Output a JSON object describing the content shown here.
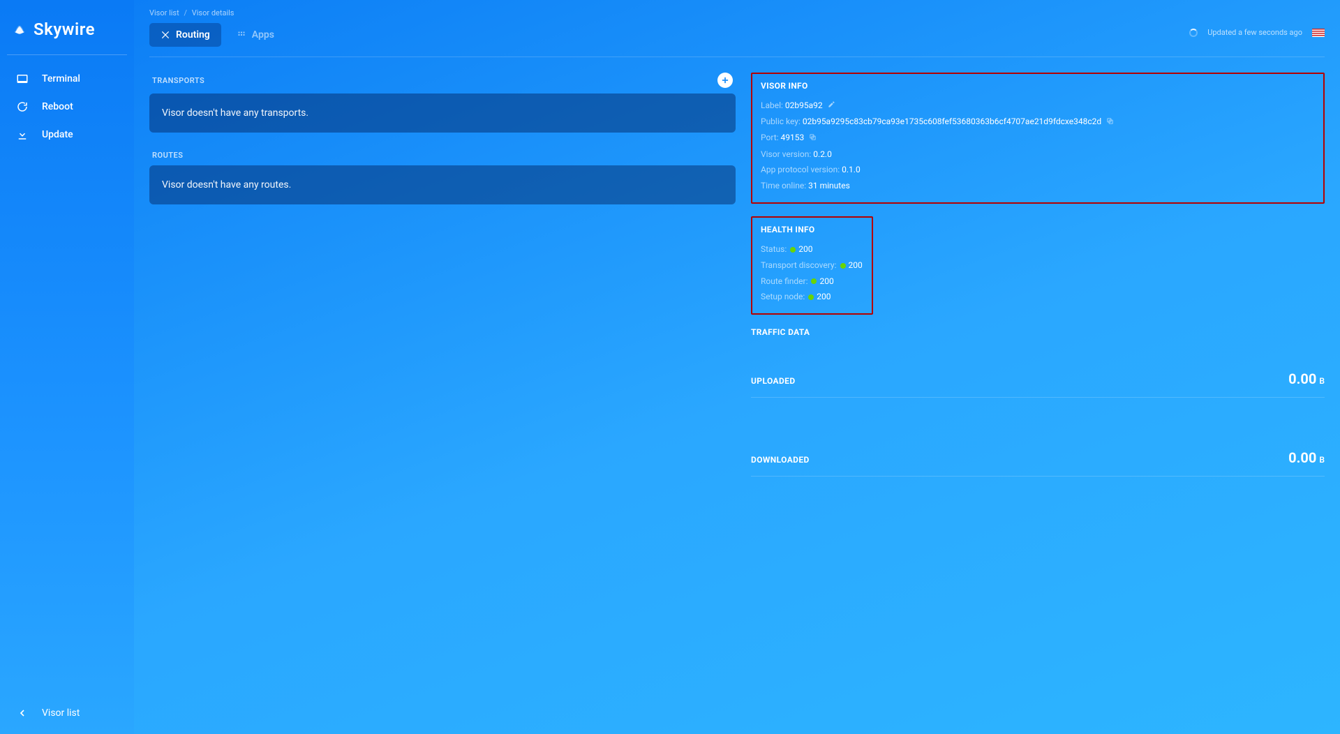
{
  "app": {
    "name": "Skywire"
  },
  "sidebar": {
    "items": [
      {
        "label": "Terminal",
        "name": "sidebar-item-terminal",
        "icon": "terminal-icon"
      },
      {
        "label": "Reboot",
        "name": "sidebar-item-reboot",
        "icon": "reboot-icon"
      },
      {
        "label": "Update",
        "name": "sidebar-item-update",
        "icon": "update-icon"
      }
    ],
    "back": {
      "label": "Visor list"
    }
  },
  "breadcrumb": {
    "root": "Visor list",
    "current": "Visor details"
  },
  "tabs": [
    {
      "label": "Routing",
      "active": true,
      "icon": "routing-icon"
    },
    {
      "label": "Apps",
      "active": false,
      "icon": "apps-icon"
    }
  ],
  "header": {
    "updated": "Updated a few seconds ago",
    "locale": "en-US"
  },
  "transports": {
    "title": "TRANSPORTS",
    "empty": "Visor doesn't have any transports."
  },
  "routes": {
    "title": "ROUTES",
    "empty": "Visor doesn't have any routes."
  },
  "visor_info": {
    "title": "VISOR INFO",
    "label_k": "Label:",
    "label_v": "02b95a92",
    "pk_k": "Public key:",
    "pk_v": "02b95a9295c83cb79ca93e1735c608fef53680363b6cf4707ae21d9fdcxe348c2d",
    "port_k": "Port:",
    "port_v": "49153",
    "visor_version_k": "Visor version:",
    "visor_version_v": "0.2.0",
    "app_proto_k": "App protocol version:",
    "app_proto_v": "0.1.0",
    "online_k": "Time online:",
    "online_v": "31 minutes"
  },
  "health": {
    "title": "HEALTH INFO",
    "status_k": "Status:",
    "status_v": "200",
    "td_k": "Transport discovery:",
    "td_v": "200",
    "rf_k": "Route finder:",
    "rf_v": "200",
    "sn_k": "Setup node:",
    "sn_v": "200"
  },
  "traffic": {
    "title": "TRAFFIC DATA",
    "uploaded_k": "UPLOADED",
    "uploaded_v": "0.00",
    "uploaded_u": "B",
    "downloaded_k": "DOWNLOADED",
    "downloaded_v": "0.00",
    "downloaded_u": "B"
  }
}
